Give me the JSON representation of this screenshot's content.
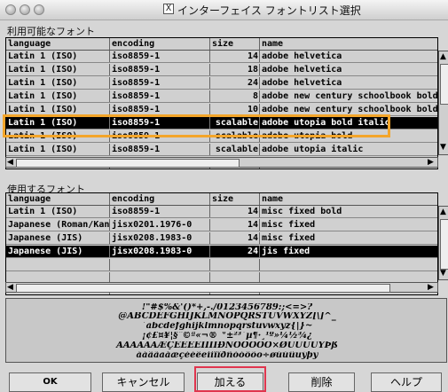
{
  "window": {
    "title": "インターフェイス フォントリスト選択",
    "x11_badge": "X"
  },
  "available": {
    "label": "利用可能なフォント",
    "headers": [
      "language",
      "encoding",
      "size",
      "name"
    ],
    "rows": [
      [
        "Latin 1 (ISO)",
        "iso8859-1",
        "14",
        "adobe helvetica"
      ],
      [
        "Latin 1 (ISO)",
        "iso8859-1",
        "18",
        "adobe helvetica"
      ],
      [
        "Latin 1 (ISO)",
        "iso8859-1",
        "24",
        "adobe helvetica"
      ],
      [
        "Latin 1 (ISO)",
        "iso8859-1",
        "8",
        "adobe new century schoolbook bold i"
      ],
      [
        "Latin 1 (ISO)",
        "iso8859-1",
        "10",
        "adobe new century schoolbook bold i"
      ],
      [
        "Latin 1 (ISO)",
        "iso8859-1",
        "scalable",
        "adobe utopia bold italic"
      ],
      [
        "Latin 1 (ISO)",
        "iso8859-1",
        "scalable",
        "adobe utopia bold"
      ],
      [
        "Latin 1 (ISO)",
        "iso8859-1",
        "scalable",
        "adobe utopia italic"
      ],
      [
        "Latin 1 (ISO)",
        "iso8859-1",
        "scalable",
        "adobe utopia"
      ]
    ],
    "selected_index": 5
  },
  "used": {
    "label": "使用するフォント",
    "headers": [
      "language",
      "encoding",
      "size",
      "name"
    ],
    "rows": [
      [
        "Latin 1 (ISO)",
        "iso8859-1",
        "14",
        "misc fixed bold"
      ],
      [
        "Japanese (Roman/Kana)",
        "jisx0201.1976-0",
        "14",
        "misc fixed"
      ],
      [
        "Japanese (JIS)",
        "jisx0208.1983-0",
        "14",
        "misc fixed"
      ],
      [
        "Japanese (JIS)",
        "jisx0208.1983-0",
        "24",
        "jis fixed"
      ],
      [
        "",
        "",
        "",
        ""
      ],
      [
        "",
        "",
        "",
        ""
      ],
      [
        "",
        "",
        "",
        ""
      ]
    ],
    "selected_index": 3
  },
  "preview": {
    "lines": [
      "!\"#$%&'()*+,-./0123456789:;<=>?",
      "@ABCDEFGHIJKLMNOPQRSTUVWXYZ[\\]^_",
      "`abcdefghijklmnopqrstuvwxyz{|}~",
      "¡¢£¤¥¦§¨©ª«¬­®¯°±²³´µ¶·¸¹º»¼½¾¿",
      "ÀÁÂÃÄÅÆÇÈÉÊËÌÍÎÏÐÑÒÓÔÕÖ×ØÙÚÛÜÝÞß",
      "àáâãäåæçèéêëìíîïðñòóôõö÷øùúûüýþÿ"
    ]
  },
  "buttons": {
    "ok": "OK",
    "cancel": "キャンセル",
    "add": "加える",
    "delete": "削除",
    "help": "ヘルプ"
  },
  "highlight_colors": {
    "selection": "#f3a52a",
    "add_button": "#e0354e"
  }
}
